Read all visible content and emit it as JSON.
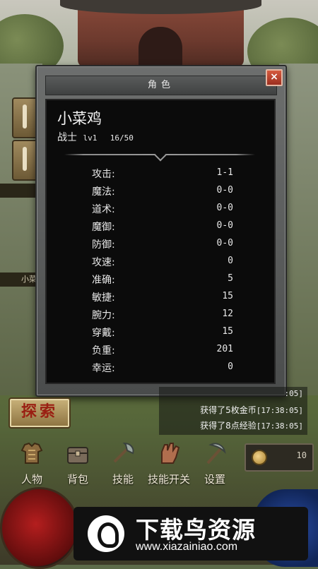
{
  "dialog": {
    "title": "角色",
    "close_glyph": "×"
  },
  "character": {
    "name": "小菜鸡",
    "class": "战士",
    "level": "lv1",
    "exp": "16/50"
  },
  "stats": [
    {
      "label": "攻击:",
      "value": "1-1"
    },
    {
      "label": "魔法:",
      "value": "0-0"
    },
    {
      "label": "道术:",
      "value": "0-0"
    },
    {
      "label": "魔御:",
      "value": "0-0"
    },
    {
      "label": "防御:",
      "value": "0-0"
    },
    {
      "label": "攻速:",
      "value": "0"
    },
    {
      "label": "准确:",
      "value": "5"
    },
    {
      "label": "敏捷:",
      "value": "15"
    },
    {
      "label": "腕力:",
      "value": "12"
    },
    {
      "label": "穿戴:",
      "value": "15"
    },
    {
      "label": "负重:",
      "value": "201"
    },
    {
      "label": "幸运:",
      "value": "0"
    }
  ],
  "side": {
    "label": "小菜"
  },
  "explore_button": "探索",
  "log": {
    "timestamp_top": ":05]",
    "lines": [
      {
        "text": "获得了5枚金币",
        "time": "[17:38:05]"
      },
      {
        "text": "获得了8点经验",
        "time": "[17:38:05]"
      }
    ]
  },
  "coins": "10",
  "menu": [
    {
      "label": "人物",
      "icon": "armor-icon"
    },
    {
      "label": "背包",
      "icon": "chest-icon"
    },
    {
      "label": "技能",
      "icon": "axe-icon"
    },
    {
      "label": "技能开关",
      "icon": "glove-icon"
    },
    {
      "label": "设置",
      "icon": "pickaxe-icon"
    }
  ],
  "watermark": {
    "title": "下载鸟资源",
    "url": "www.xiazainiao.com"
  },
  "colors": {
    "panel_bg": "#0b0b0b",
    "text": "#e8e8e8",
    "close": "#c0432c",
    "explore_text": "#9a1f12"
  }
}
